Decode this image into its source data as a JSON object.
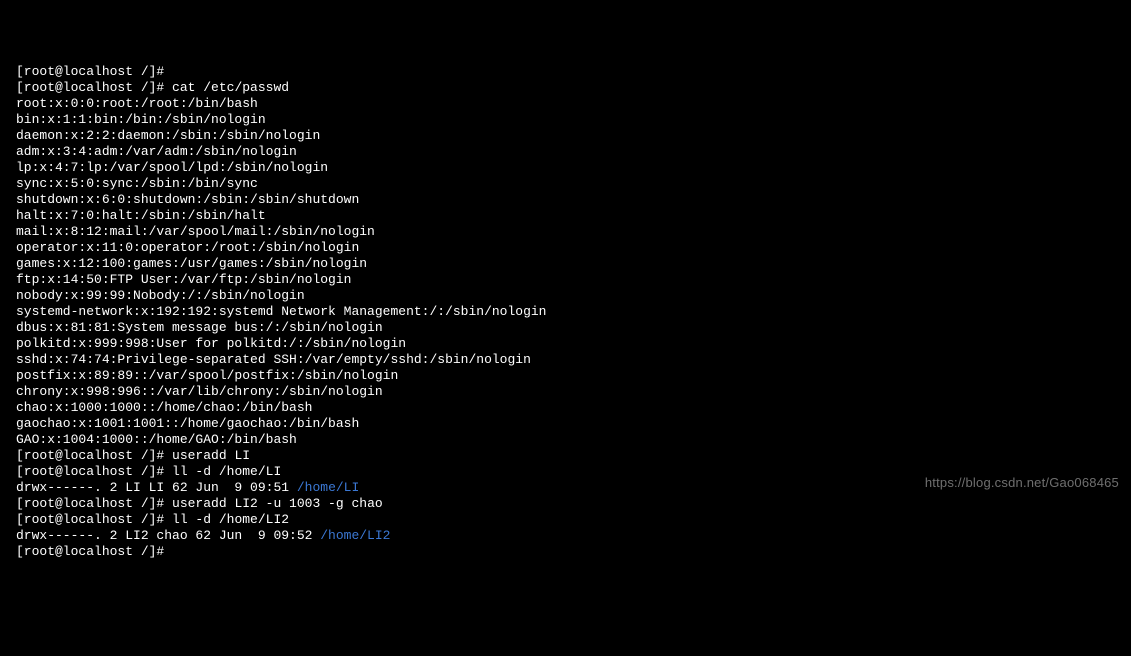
{
  "terminal": {
    "lines": [
      {
        "prompt": "[root@localhost /]# ",
        "cmd": ""
      },
      {
        "prompt": "[root@localhost /]# ",
        "cmd": "cat /etc/passwd"
      },
      {
        "text": "root:x:0:0:root:/root:/bin/bash"
      },
      {
        "text": "bin:x:1:1:bin:/bin:/sbin/nologin"
      },
      {
        "text": "daemon:x:2:2:daemon:/sbin:/sbin/nologin"
      },
      {
        "text": "adm:x:3:4:adm:/var/adm:/sbin/nologin"
      },
      {
        "text": "lp:x:4:7:lp:/var/spool/lpd:/sbin/nologin"
      },
      {
        "text": "sync:x:5:0:sync:/sbin:/bin/sync"
      },
      {
        "text": "shutdown:x:6:0:shutdown:/sbin:/sbin/shutdown"
      },
      {
        "text": "halt:x:7:0:halt:/sbin:/sbin/halt"
      },
      {
        "text": "mail:x:8:12:mail:/var/spool/mail:/sbin/nologin"
      },
      {
        "text": "operator:x:11:0:operator:/root:/sbin/nologin"
      },
      {
        "text": "games:x:12:100:games:/usr/games:/sbin/nologin"
      },
      {
        "text": "ftp:x:14:50:FTP User:/var/ftp:/sbin/nologin"
      },
      {
        "text": "nobody:x:99:99:Nobody:/:/sbin/nologin"
      },
      {
        "text": "systemd-network:x:192:192:systemd Network Management:/:/sbin/nologin"
      },
      {
        "text": "dbus:x:81:81:System message bus:/:/sbin/nologin"
      },
      {
        "text": "polkitd:x:999:998:User for polkitd:/:/sbin/nologin"
      },
      {
        "text": "sshd:x:74:74:Privilege-separated SSH:/var/empty/sshd:/sbin/nologin"
      },
      {
        "text": "postfix:x:89:89::/var/spool/postfix:/sbin/nologin"
      },
      {
        "text": "chrony:x:998:996::/var/lib/chrony:/sbin/nologin"
      },
      {
        "text": "chao:x:1000:1000::/home/chao:/bin/bash"
      },
      {
        "text": "gaochao:x:1001:1001::/home/gaochao:/bin/bash"
      },
      {
        "text": "GAO:x:1004:1000::/home/GAO:/bin/bash"
      },
      {
        "prompt": "[root@localhost /]# ",
        "cmd": "useradd LI"
      },
      {
        "prompt": "[root@localhost /]# ",
        "cmd": "ll -d /home/LI"
      },
      {
        "text": "drwx------. 2 LI LI 62 Jun  9 09:51 ",
        "hl": "/home/LI"
      },
      {
        "prompt": "[root@localhost /]# ",
        "cmd": "useradd LI2 -u 1003 -g chao"
      },
      {
        "prompt": "[root@localhost /]# ",
        "cmd": "ll -d /home/LI2"
      },
      {
        "text": "drwx------. 2 LI2 chao 62 Jun  9 09:52 ",
        "hl": "/home/LI2"
      },
      {
        "prompt": "[root@localhost /]# ",
        "cmd": ""
      }
    ]
  },
  "watermark": "https://blog.csdn.net/Gao068465"
}
